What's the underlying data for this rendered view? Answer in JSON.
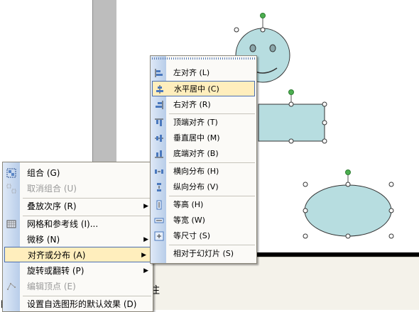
{
  "notes": {
    "text": "注"
  },
  "bottom_char": "目",
  "context_menu": {
    "items": [
      {
        "label": "组合 (G)",
        "icon": "group-icon",
        "enabled": true
      },
      {
        "label": "取消组合 (U)",
        "icon": "ungroup-icon",
        "enabled": false
      },
      {
        "label": "叠放次序 (R)",
        "icon": "",
        "enabled": true,
        "submenu": true
      },
      {
        "label": "网格和参考线 (I)...",
        "icon": "grid-icon",
        "enabled": true
      },
      {
        "label": "微移 (N)",
        "icon": "",
        "enabled": true,
        "submenu": true
      },
      {
        "label": "对齐或分布 (A)",
        "icon": "",
        "enabled": true,
        "submenu": true,
        "highlighted": true
      },
      {
        "label": "旋转或翻转 (P)",
        "icon": "",
        "enabled": true,
        "submenu": true
      },
      {
        "label": "编辑顶点 (E)",
        "icon": "edit-points-icon",
        "enabled": false
      },
      {
        "label": "设置自选图形的默认效果 (D)",
        "icon": "",
        "enabled": true
      }
    ]
  },
  "submenu": {
    "items": [
      {
        "label": "左对齐 (L)",
        "icon": "align-left-icon"
      },
      {
        "label": "水平居中 (C)",
        "icon": "align-center-icon",
        "highlighted": true
      },
      {
        "label": "右对齐 (R)",
        "icon": "align-right-icon"
      },
      {
        "label": "顶端对齐 (T)",
        "icon": "align-top-icon"
      },
      {
        "label": "垂直居中 (M)",
        "icon": "align-middle-icon"
      },
      {
        "label": "底端对齐 (B)",
        "icon": "align-bottom-icon"
      },
      {
        "label": "横向分布 (H)",
        "icon": "distribute-horizontal-icon"
      },
      {
        "label": "纵向分布 (V)",
        "icon": "distribute-vertical-icon"
      },
      {
        "label": "等高 (H)",
        "icon": "same-height-icon"
      },
      {
        "label": "等宽 (W)",
        "icon": "same-width-icon"
      },
      {
        "label": "等尺寸 (S)",
        "icon": "same-size-icon"
      },
      {
        "label": "相对于幻灯片 (S)",
        "icon": ""
      }
    ]
  },
  "colors": {
    "shape_fill": "#b7dde0",
    "highlight": "#ffeebd",
    "handle_rotate": "#4caf50"
  }
}
